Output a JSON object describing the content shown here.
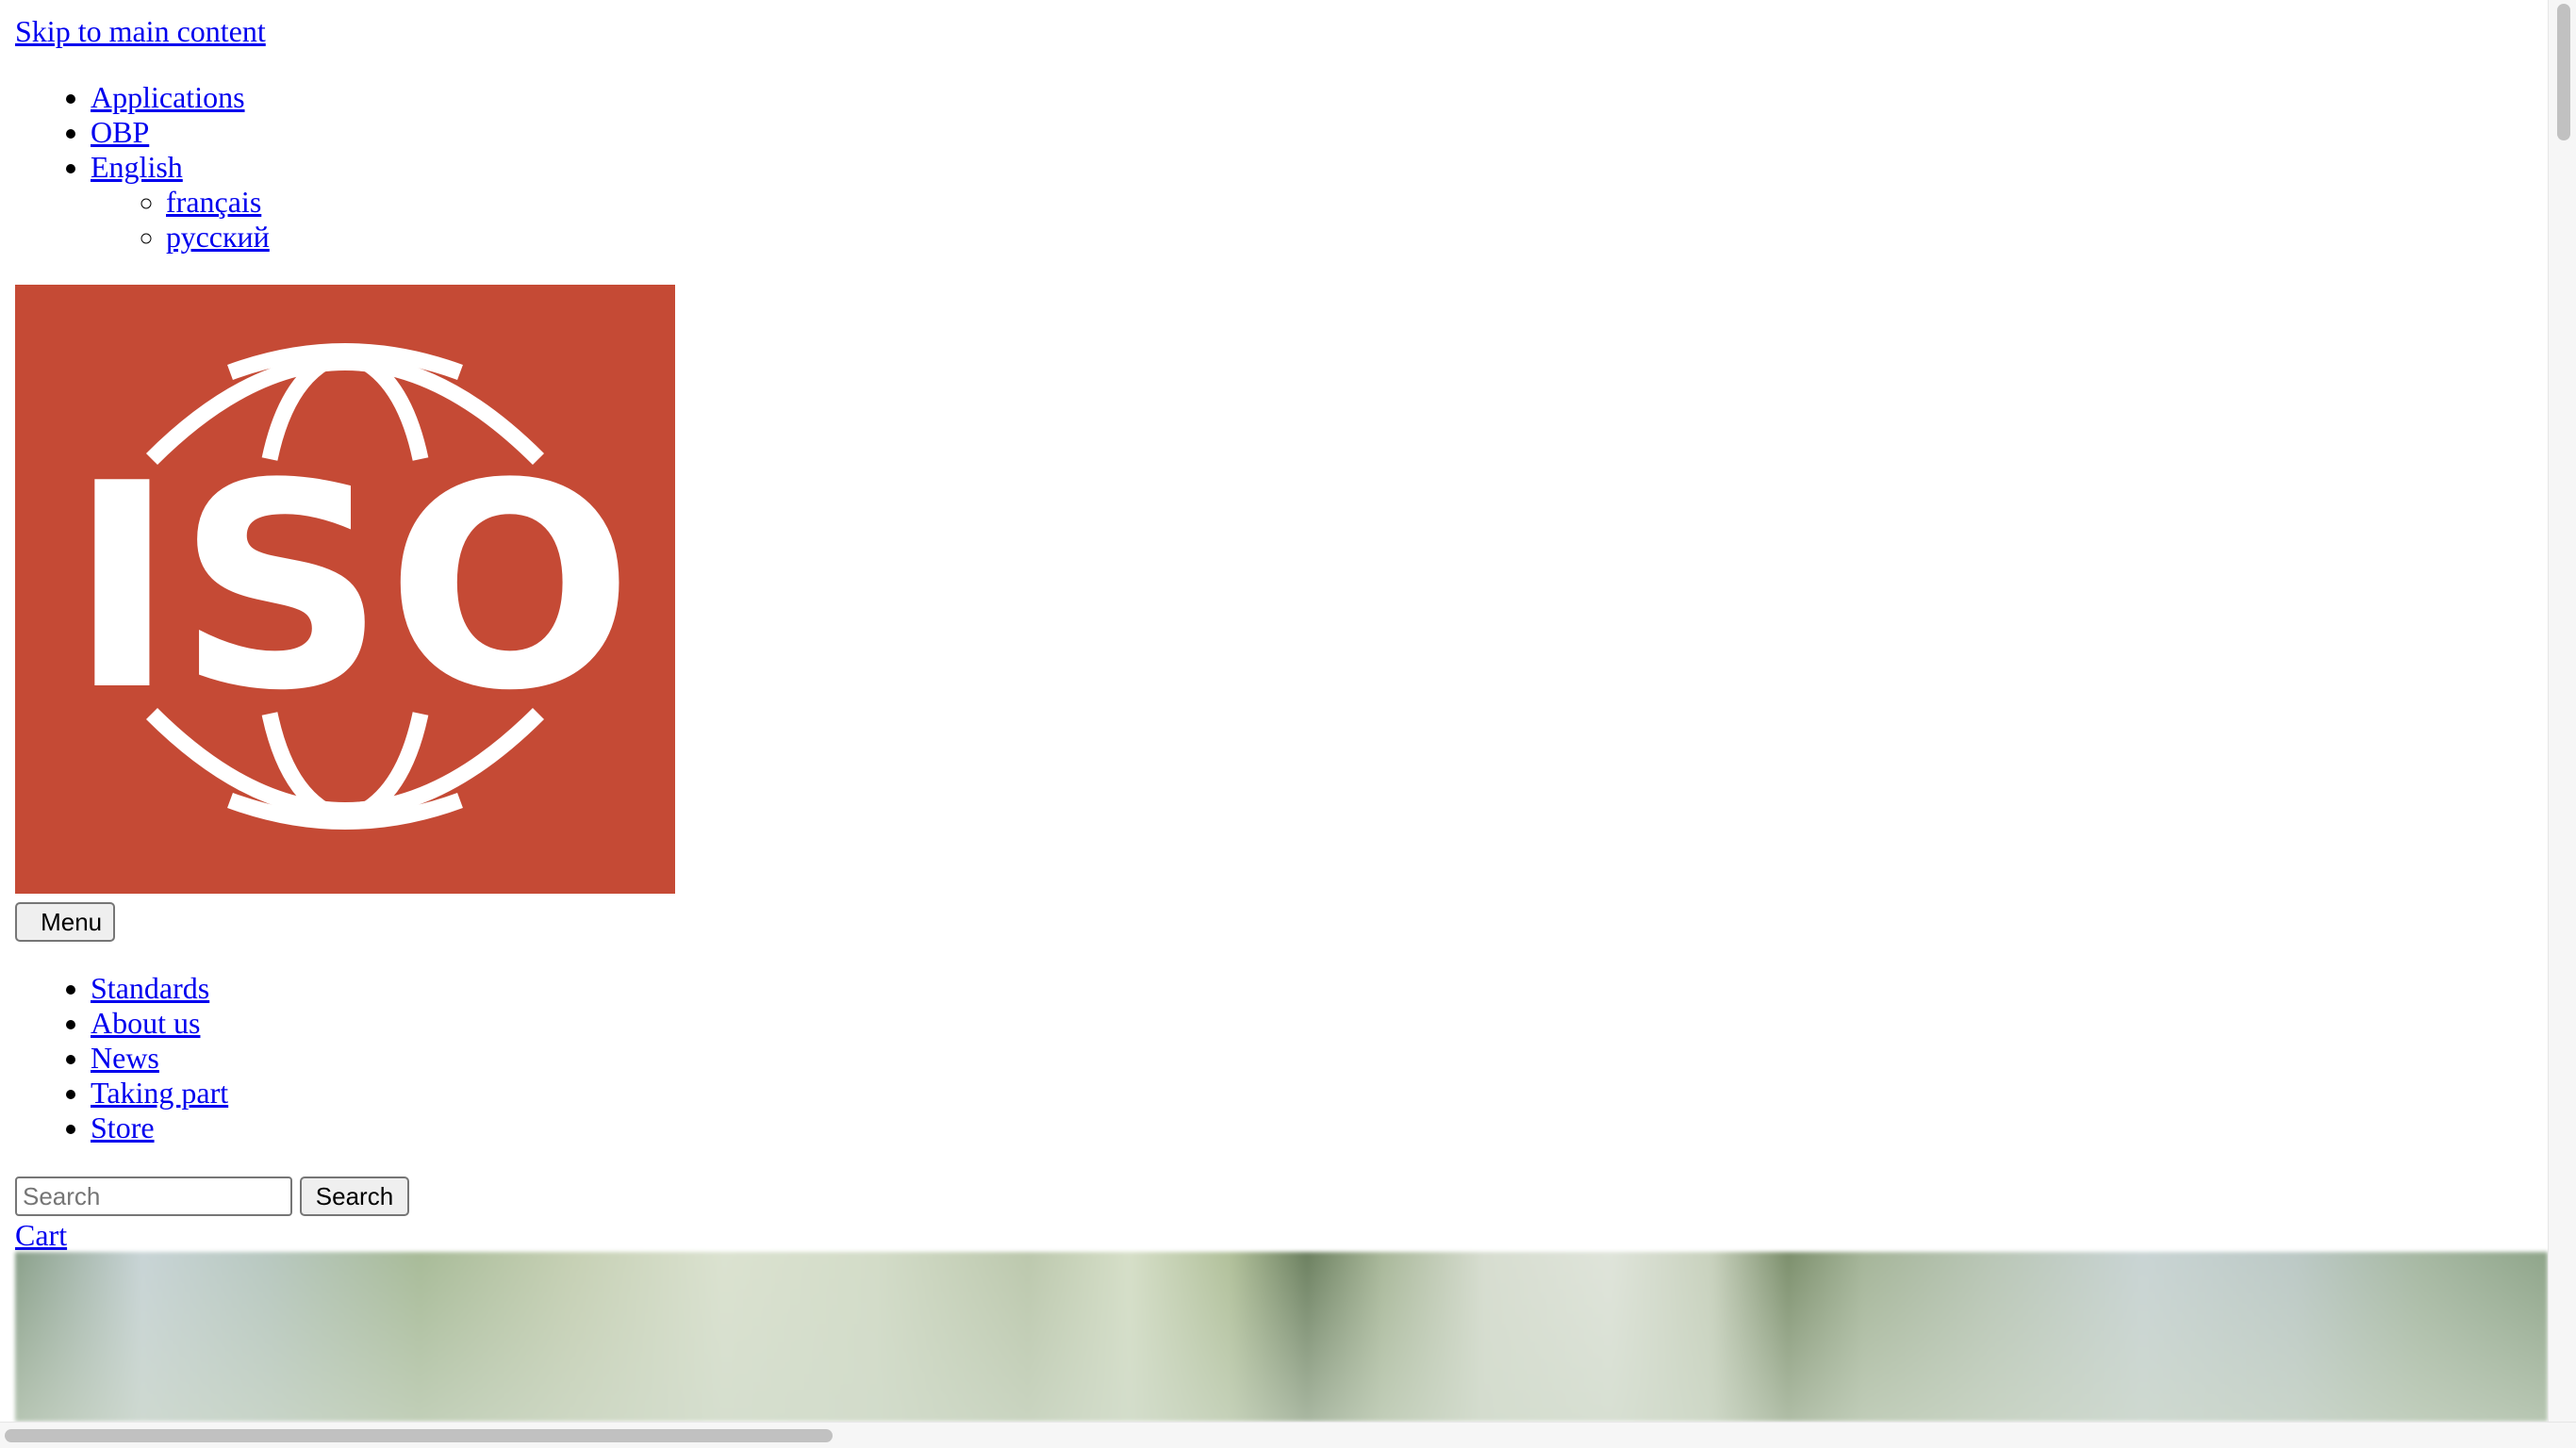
{
  "skip_link": "Skip to main content",
  "top_nav": {
    "items": [
      {
        "icon": "applications-icon",
        "label": " Applications"
      },
      {
        "icon": "obp-icon",
        "label": " OBP"
      },
      {
        "label": "English"
      }
    ],
    "language_options": [
      "français",
      "русский"
    ]
  },
  "logo": {
    "text": "ISO",
    "background_color": "#c54a35",
    "foreground_color": "#ffffff"
  },
  "menu_button": {
    "label": "Menu",
    "icon": "hamburger-icon"
  },
  "main_nav": {
    "items": [
      "Standards",
      "About us",
      "News",
      "Taking part",
      "Store"
    ]
  },
  "search": {
    "placeholder": "Search",
    "value": "",
    "button_label": "Search"
  },
  "cart": {
    "label": " Cart",
    "icon": "cart-icon"
  },
  "colors": {
    "link": "#0000ee",
    "logo_red": "#c54a35"
  }
}
